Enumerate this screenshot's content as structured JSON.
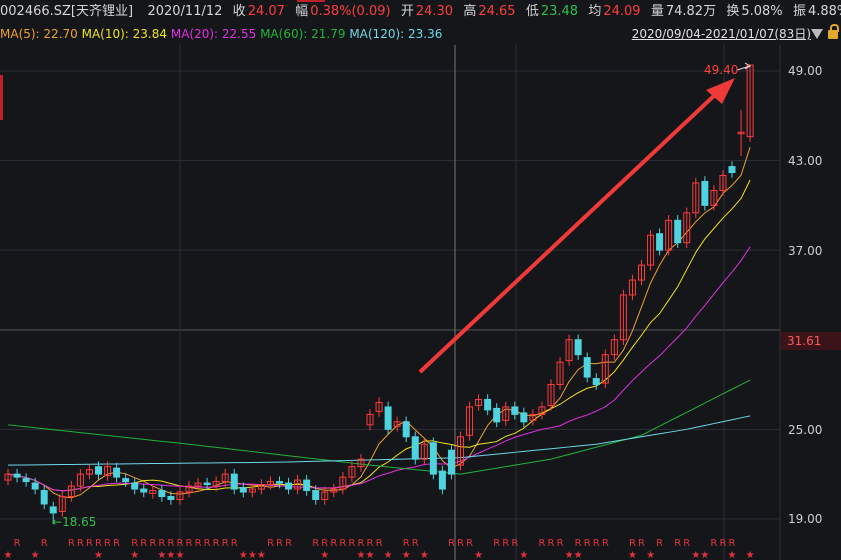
{
  "header": {
    "symbol": "002466.SZ[天齐锂业]",
    "date": "2020/11/12",
    "close_label": "收",
    "close": "24.07",
    "change_label": "幅",
    "change": "0.38%(0.09)",
    "open_label": "开",
    "open": "24.30",
    "high_label": "高",
    "high": "24.65",
    "low_label": "低",
    "low": "23.48",
    "avg_label": "均",
    "avg": "24.09",
    "vol_label": "量",
    "vol": "74.82万",
    "turnover_label": "换",
    "turnover": "5.08%",
    "amp_label": "振",
    "amp": "4.88%"
  },
  "ma_legend": [
    {
      "text": "MA(5): 22.70",
      "color": "#f0a030"
    },
    {
      "text": "MA(10): 23.84",
      "color": "#f2e21c"
    },
    {
      "text": "MA(20): 22.55",
      "color": "#e030e0"
    },
    {
      "text": "MA(60): 21.79",
      "color": "#22b33a"
    },
    {
      "text": "MA(120): 23.36",
      "color": "#6fd8e8"
    }
  ],
  "range": "2020/09/04-2021/01/07(83日)",
  "axis": {
    "ticks": [
      "49.00",
      "43.00",
      "37.00",
      "25.00",
      "19.00"
    ],
    "current": "31.61"
  },
  "annotations": {
    "max": "49.40",
    "min": "18.65"
  },
  "colors": {
    "up": "#ff3b3b",
    "down": "#4fd3df",
    "bg": "#14161a",
    "grid": "#2c2f36",
    "arrow": "#f03a3a"
  },
  "chart_data": {
    "type": "candlestick",
    "ylim": [
      18,
      50.5
    ],
    "open": [
      21.6,
      22.0,
      21.7,
      21.4,
      20.9,
      19.8,
      19.5,
      20.5,
      21.2,
      22.0,
      22.5,
      21.9,
      22.4,
      21.7,
      21.4,
      21.0,
      20.7,
      20.9,
      20.5,
      20.3,
      20.8,
      21.2,
      21.4,
      21.2,
      21.5,
      22.0,
      21.1,
      20.8,
      21.0,
      21.3,
      21.5,
      21.4,
      21.0,
      21.6,
      20.9,
      20.3,
      20.8,
      21.0,
      21.8,
      22.5,
      25.3,
      26.2,
      26.5,
      25.2,
      25.5,
      24.5,
      23.0,
      24.1,
      22.2,
      23.6,
      22.6,
      24.6,
      26.6,
      27.0,
      26.4,
      25.6,
      26.5,
      26.1,
      25.6,
      26.0,
      26.6,
      28.0,
      29.6,
      31.0,
      29.8,
      28.4,
      28.1,
      30.0,
      31.0,
      34.0,
      35.0,
      36.0,
      38.1,
      37.0,
      39.0,
      37.5,
      39.5,
      41.6,
      40.0,
      41.0,
      42.6,
      44.8,
      44.6
    ],
    "close": [
      22.0,
      21.8,
      21.5,
      21.0,
      20.0,
      19.4,
      20.5,
      21.2,
      22.0,
      22.3,
      22.0,
      22.5,
      21.8,
      21.5,
      21.0,
      20.8,
      20.9,
      20.5,
      20.3,
      20.8,
      21.2,
      21.4,
      21.3,
      21.5,
      22.0,
      21.0,
      20.8,
      21.0,
      21.3,
      21.5,
      21.4,
      21.0,
      21.6,
      20.9,
      20.3,
      20.8,
      21.0,
      21.8,
      22.5,
      23.0,
      26.0,
      26.8,
      25.0,
      25.5,
      24.5,
      23.0,
      24.0,
      22.0,
      21.0,
      22.0,
      24.5,
      26.5,
      27.0,
      26.3,
      25.5,
      26.5,
      26.0,
      25.5,
      26.0,
      26.5,
      28.0,
      29.5,
      31.0,
      30.0,
      28.5,
      28.0,
      30.0,
      31.0,
      34.0,
      35.0,
      36.0,
      38.0,
      37.0,
      39.0,
      37.5,
      39.5,
      41.5,
      40.0,
      41.0,
      42.0,
      42.2,
      44.9,
      49.4
    ],
    "low_min": 18.65,
    "high_max": 49.4,
    "ma60_points": [
      [
        0,
        25.3
      ],
      [
        20,
        24.0
      ],
      [
        40,
        22.6
      ],
      [
        50,
        22.0
      ],
      [
        60,
        23.0
      ],
      [
        70,
        24.6
      ],
      [
        82,
        28.3
      ]
    ],
    "ma120_points": [
      [
        0,
        22.6
      ],
      [
        30,
        22.8
      ],
      [
        50,
        23.1
      ],
      [
        65,
        24.0
      ],
      [
        75,
        25.0
      ],
      [
        82,
        25.9
      ]
    ],
    "signals": {
      "R": [
        1,
        4,
        7,
        8,
        9,
        10,
        11,
        12,
        14,
        15,
        16,
        17,
        18,
        19,
        20,
        21,
        22,
        23,
        24,
        25,
        29,
        30,
        31,
        34,
        35,
        36,
        37,
        38,
        39,
        40,
        41,
        44,
        45,
        49,
        50,
        51,
        54,
        55,
        56,
        59,
        60,
        61,
        63,
        64,
        65,
        66,
        69,
        70,
        72,
        74,
        75,
        78,
        79,
        80
      ],
      "star": [
        0,
        3,
        10,
        14,
        17,
        18,
        19,
        26,
        27,
        28,
        35,
        39,
        40,
        42,
        44,
        46,
        52,
        57,
        62,
        63,
        69,
        71,
        76,
        77,
        80,
        82
      ]
    },
    "signal_labels": {
      "R": "R",
      "star": "★"
    }
  }
}
